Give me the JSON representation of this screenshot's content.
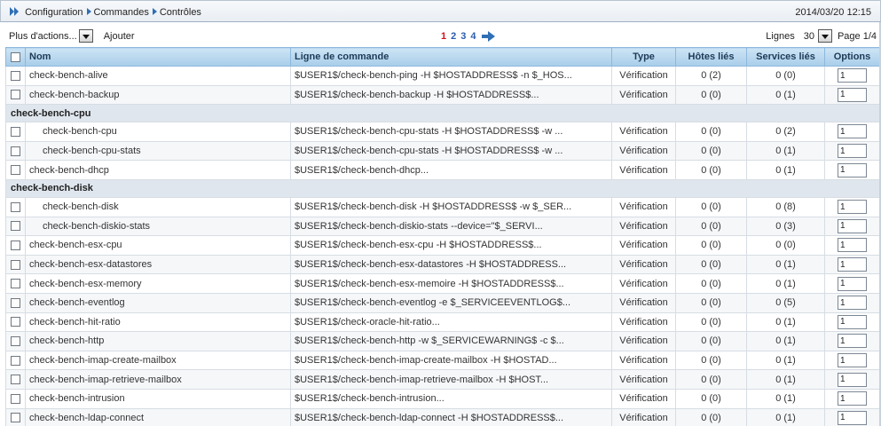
{
  "breadcrumb": {
    "items": [
      "Configuration",
      "Commandes",
      "Contrôles"
    ]
  },
  "datetime": "2014/03/20 12:15",
  "toolbar": {
    "actions_label": "Plus d'actions...",
    "add_label": "Ajouter",
    "pages": [
      "1",
      "2",
      "3",
      "4"
    ],
    "current_page": "1",
    "lines_label": "Lignes",
    "lines_value": "30",
    "page_info": "Page 1/4"
  },
  "table": {
    "headers": {
      "name": "Nom",
      "command": "Ligne de commande",
      "type": "Type",
      "hosts": "Hôtes liés",
      "services": "Services liés",
      "options": "Options"
    },
    "rows": [
      {
        "kind": "item",
        "name": "check-bench-alive",
        "command": "$USER1$/check-bench-ping -H $HOSTADDRESS$ -n $_HOS...",
        "type": "Vérification",
        "hosts": "0 (2)",
        "services": "0 (0)",
        "option": "1",
        "sub": false
      },
      {
        "kind": "item",
        "name": "check-bench-backup",
        "command": "$USER1$/check-bench-backup -H $HOSTADDRESS$...",
        "type": "Vérification",
        "hosts": "0 (0)",
        "services": "0 (1)",
        "option": "1",
        "sub": false
      },
      {
        "kind": "group",
        "name": "check-bench-cpu"
      },
      {
        "kind": "item",
        "name": "check-bench-cpu",
        "command": "$USER1$/check-bench-cpu-stats -H $HOSTADDRESS$ -w ...",
        "type": "Vérification",
        "hosts": "0 (0)",
        "services": "0 (2)",
        "option": "1",
        "sub": true
      },
      {
        "kind": "item",
        "name": "check-bench-cpu-stats",
        "command": "$USER1$/check-bench-cpu-stats -H $HOSTADDRESS$ -w ...",
        "type": "Vérification",
        "hosts": "0 (0)",
        "services": "0 (1)",
        "option": "1",
        "sub": true
      },
      {
        "kind": "item",
        "name": "check-bench-dhcp",
        "command": "$USER1$/check-bench-dhcp...",
        "type": "Vérification",
        "hosts": "0 (0)",
        "services": "0 (1)",
        "option": "1",
        "sub": false
      },
      {
        "kind": "group",
        "name": "check-bench-disk"
      },
      {
        "kind": "item",
        "name": "check-bench-disk",
        "command": "$USER1$/check-bench-disk -H $HOSTADDRESS$ -w $_SER...",
        "type": "Vérification",
        "hosts": "0 (0)",
        "services": "0 (8)",
        "option": "1",
        "sub": true
      },
      {
        "kind": "item",
        "name": "check-bench-diskio-stats",
        "command": "$USER1$/check-bench-diskio-stats --device=\"$_SERVI...",
        "type": "Vérification",
        "hosts": "0 (0)",
        "services": "0 (3)",
        "option": "1",
        "sub": true
      },
      {
        "kind": "item",
        "name": "check-bench-esx-cpu",
        "command": "$USER1$/check-bench-esx-cpu -H $HOSTADDRESS$...",
        "type": "Vérification",
        "hosts": "0 (0)",
        "services": "0 (0)",
        "option": "1",
        "sub": false
      },
      {
        "kind": "item",
        "name": "check-bench-esx-datastores",
        "command": "$USER1$/check-bench-esx-datastores -H $HOSTADDRESS...",
        "type": "Vérification",
        "hosts": "0 (0)",
        "services": "0 (1)",
        "option": "1",
        "sub": false
      },
      {
        "kind": "item",
        "name": "check-bench-esx-memory",
        "command": "$USER1$/check-bench-esx-memoire -H $HOSTADDRESS$...",
        "type": "Vérification",
        "hosts": "0 (0)",
        "services": "0 (1)",
        "option": "1",
        "sub": false
      },
      {
        "kind": "item",
        "name": "check-bench-eventlog",
        "command": "$USER1$/check-bench-eventlog -e $_SERVICEEVENTLOG$...",
        "type": "Vérification",
        "hosts": "0 (0)",
        "services": "0 (5)",
        "option": "1",
        "sub": false
      },
      {
        "kind": "item",
        "name": "check-bench-hit-ratio",
        "command": "$USER1$/check-oracle-hit-ratio...",
        "type": "Vérification",
        "hosts": "0 (0)",
        "services": "0 (1)",
        "option": "1",
        "sub": false
      },
      {
        "kind": "item",
        "name": "check-bench-http",
        "command": "$USER1$/check-bench-http -w $_SERVICEWARNING$ -c $...",
        "type": "Vérification",
        "hosts": "0 (0)",
        "services": "0 (1)",
        "option": "1",
        "sub": false
      },
      {
        "kind": "item",
        "name": "check-bench-imap-create-mailbox",
        "command": "$USER1$/check-bench-imap-create-mailbox -H $HOSTAD...",
        "type": "Vérification",
        "hosts": "0 (0)",
        "services": "0 (1)",
        "option": "1",
        "sub": false
      },
      {
        "kind": "item",
        "name": "check-bench-imap-retrieve-mailbox",
        "command": "$USER1$/check-bench-imap-retrieve-mailbox -H $HOST...",
        "type": "Vérification",
        "hosts": "0 (0)",
        "services": "0 (1)",
        "option": "1",
        "sub": false
      },
      {
        "kind": "item",
        "name": "check-bench-intrusion",
        "command": "$USER1$/check-bench-intrusion...",
        "type": "Vérification",
        "hosts": "0 (0)",
        "services": "0 (1)",
        "option": "1",
        "sub": false
      },
      {
        "kind": "item",
        "name": "check-bench-ldap-connect",
        "command": "$USER1$/check-bench-ldap-connect -H $HOSTADDRESS$...",
        "type": "Vérification",
        "hosts": "0 (0)",
        "services": "0 (1)",
        "option": "1",
        "sub": false
      }
    ]
  },
  "colors": {
    "accent": "#2f6fb5",
    "current_page": "#d0121b",
    "header_bg": "#a9cde9"
  }
}
